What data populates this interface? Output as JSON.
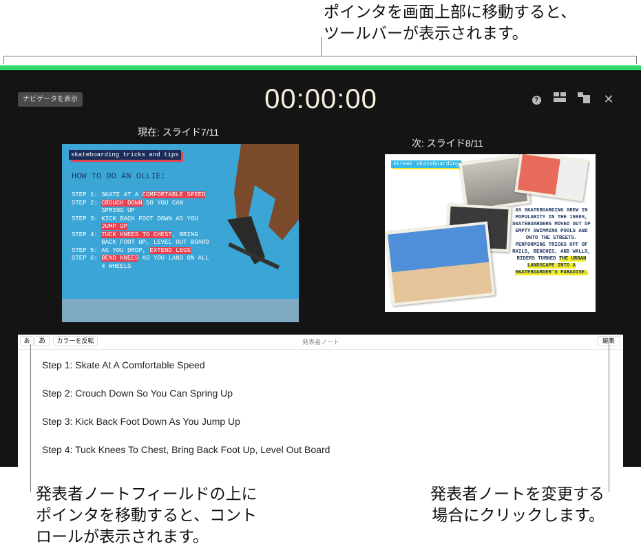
{
  "callouts": {
    "top": [
      "ポインタを画面上部に移動すると、",
      "ツールバーが表示されます。"
    ],
    "bottom_left": [
      "発表者ノートフィールドの上に",
      "ポインタを移動すると、コント",
      "ロールが表示されます。"
    ],
    "bottom_right": [
      "発表者ノートを変更する",
      "場合にクリックします。"
    ]
  },
  "colors": {
    "toolbar_accent": "#2fdc6a",
    "panel": "#141414",
    "timer": "#f6f1de"
  },
  "toolbar": {
    "navigator_button": "ナビゲータを表示",
    "timer": "00:00:00",
    "icons": [
      "help-icon",
      "layout-icon",
      "swap-displays-icon",
      "close-icon"
    ]
  },
  "current": {
    "label": "現在: スライド7/11",
    "slide": {
      "tag": "skateboarding tricks and tips",
      "heading": "HOW TO DO AN OLLIE:",
      "steps": [
        [
          "STEP 1: SKATE AT A ",
          "COMFORTABLE SPEED",
          ""
        ],
        [
          "STEP 2: ",
          "CROUCH DOWN",
          " SO YOU CAN\n        SPRING UP"
        ],
        [
          "STEP 3: KICK BACK FOOT DOWN AS YOU\n        ",
          "JUMP UP",
          ""
        ],
        [
          "STEP 4: ",
          "TUCK KNEES TO CHEST",
          ", BRING\n        BACK FOOT UP, LEVEL OUT BOARD"
        ],
        [
          "STEP 5: AS YOU DROP, ",
          "EXTEND LEGS",
          ""
        ],
        [
          "STEP 6: ",
          "BEND KNEES",
          " AS YOU LAND ON ALL\n        4 WHEELS"
        ]
      ]
    }
  },
  "next": {
    "label": "次: スライド8/11",
    "slide": {
      "tag": "street skateboarding",
      "body": "AS SKATEBOARDING GREW IN POPULARITY IN THE 1980S, SKATEBOARDERS MOVED OUT OF EMPTY SWIMMING POOLS AND ONTO THE STREETS. PERFORMING TRICKS OFF OF RAILS, BENCHES, AND WALLS, RIDERS TURNED ",
      "body_highlight": "THE URBAN LANDSCAPE INTO A SKATEBOARDER'S PARADISE."
    }
  },
  "notes": {
    "font_smaller": "あ",
    "font_larger": "あ",
    "invert_colors": "カラーを反転",
    "title": "発表者ノート",
    "edit": "編集",
    "lines": [
      "Step 1: Skate At A Comfortable Speed",
      "Step 2: Crouch Down So You Can Spring Up",
      "Step 3: Kick Back Foot Down As You Jump Up",
      "Step 4: Tuck Knees To Chest, Bring Back Foot Up, Level Out Board"
    ]
  }
}
